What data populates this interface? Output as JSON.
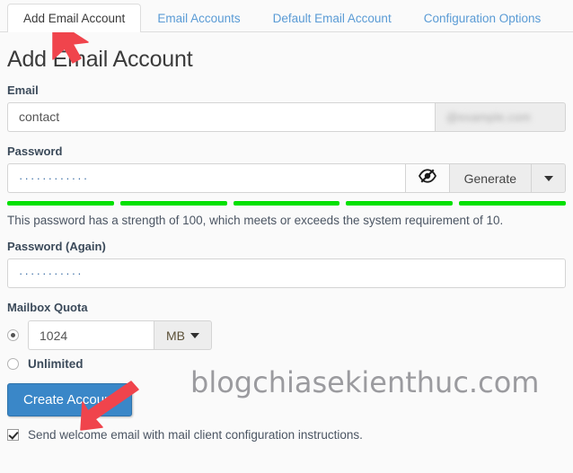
{
  "tabs": [
    {
      "label": "Add Email Account",
      "active": true
    },
    {
      "label": "Email Accounts",
      "active": false
    },
    {
      "label": "Default Email Account",
      "active": false
    },
    {
      "label": "Configuration Options",
      "active": false
    }
  ],
  "page_title": "Add Email Account",
  "email": {
    "label": "Email",
    "value": "contact",
    "placeholder": "",
    "domain_suffix": "@example.com"
  },
  "password": {
    "label": "Password",
    "value": "············",
    "eye_icon": "eye-slash-icon",
    "generate_label": "Generate",
    "caret_icon": "caret-down-icon",
    "strength_segments": 5,
    "strength_color": "#00e000",
    "strength_text": "This password has a strength of 100, which meets or exceeds the system requirement of 10.",
    "strength_value": "100",
    "strength_requirement": "10"
  },
  "password_again": {
    "label": "Password (Again)",
    "value": "···········"
  },
  "quota": {
    "label": "Mailbox Quota",
    "value": "1024",
    "unit": "MB",
    "unit_caret_icon": "caret-down-icon",
    "selected_option": "fixed",
    "unlimited_label": "Unlimited"
  },
  "create_button": {
    "label": "Create Account",
    "color": "#3a87c8"
  },
  "welcome_checkbox": {
    "label": "Send welcome email with mail client configuration instructions.",
    "checked": true
  },
  "watermark": "blogchiasekienthuc.com",
  "annotations": {
    "arrow_color": "#f0444c",
    "arrow_tab": "arrow-pointing-to-add-email-account-tab",
    "arrow_create": "arrow-pointing-to-create-account-button"
  }
}
